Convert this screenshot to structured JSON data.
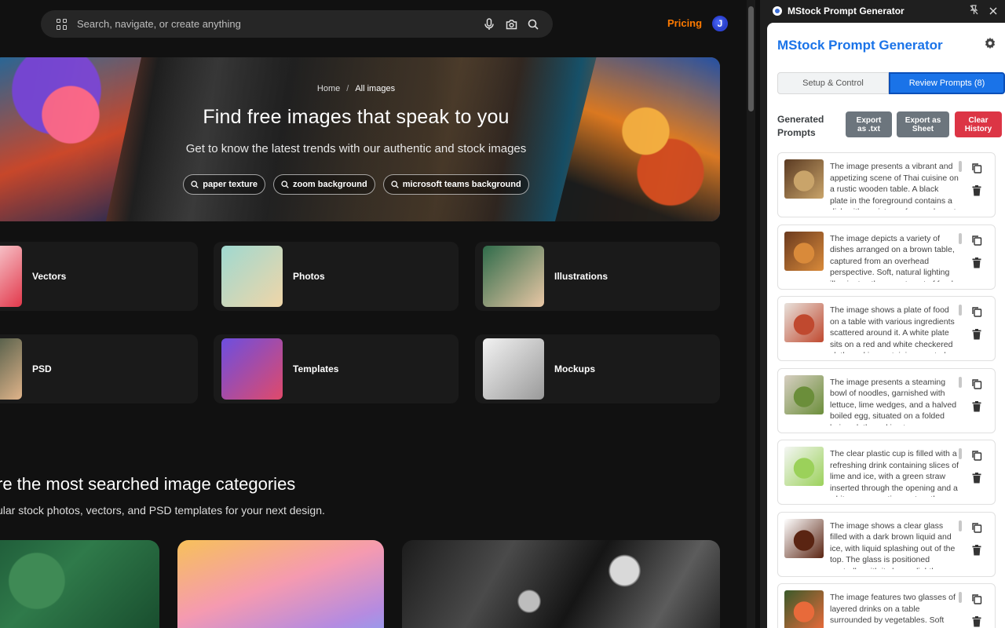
{
  "page": {
    "search_placeholder": "Search, navigate, or create anything",
    "pricing": "Pricing",
    "avatar_initial": "J",
    "hero": {
      "breadcrumb_home": "Home",
      "breadcrumb_separator": "/",
      "breadcrumb_current": "All images",
      "title": "Find free images that speak to you",
      "subtitle": "Get to know the latest trends with our authentic and stock images",
      "tags": [
        "paper texture",
        "zoom background",
        "microsoft teams background"
      ]
    },
    "categories": [
      {
        "label": "Vectors",
        "color_a": "#ffffff",
        "color_b": "#e2384b"
      },
      {
        "label": "Photos",
        "color_a": "#9fd8d0",
        "color_b": "#f0d6a8"
      },
      {
        "label": "Illustrations",
        "color_a": "#2f6b4a",
        "color_b": "#e9c7a5"
      },
      {
        "label": "PSD",
        "color_a": "#1b3b2f",
        "color_b": "#e0b48a"
      },
      {
        "label": "Templates",
        "color_a": "#6c4ee0",
        "color_b": "#e04a6a"
      },
      {
        "label": "Mockups",
        "color_a": "#f2f2f2",
        "color_b": "#9a9a9a"
      }
    ],
    "section_title": "re the most searched image categories",
    "section_subtitle": "ular stock photos, vectors, and PSD templates for your next design."
  },
  "extension": {
    "window_title": "MStock Prompt Generator",
    "heading": "MStock Prompt Generator",
    "tab_setup": "Setup & Control",
    "tab_review": "Review Prompts (8)",
    "generated_label_1": "Generated",
    "generated_label_2": "Prompts",
    "export_txt_1": "Export",
    "export_txt_2": "as .txt",
    "export_sheet_1": "Export as",
    "export_sheet_2": "Sheet",
    "clear_1": "Clear",
    "clear_2": "History",
    "accent": "#1a73e8",
    "prompts": [
      {
        "text": "The image presents a vibrant and appetizing scene of Thai cuisine on a rustic wooden table. A black plate in the foreground contains a dish with a mixture of ground meat",
        "color_a": "#5a3a22",
        "color_b": "#c9a46a"
      },
      {
        "text": "The image depicts a variety of dishes arranged on a brown table, captured from an overhead perspective. Soft, natural lighting illuminates the assortment of food",
        "color_a": "#6b3a1e",
        "color_b": "#d98a3a"
      },
      {
        "text": "The image shows a plate of food on a table with various ingredients scattered around it. A white plate sits on a red and white checkered cloth napkin, containing roasted",
        "color_a": "#e8e2dc",
        "color_b": "#c0492f"
      },
      {
        "text": "The image presents a steaming bowl of noodles, garnished with lettuce, lime wedges, and a halved boiled egg, situated on a folded beige cloth napkin atop a",
        "color_a": "#d7cfc2",
        "color_b": "#6b8e3a"
      },
      {
        "text": "The clear plastic cup is filled with a refreshing drink containing slices of lime and ice, with a green straw inserted through the opening and a white spoon resting on top; the",
        "color_a": "#f4f6f4",
        "color_b": "#9bd15a"
      },
      {
        "text": "The image shows a clear glass filled with a dark brown liquid and ice, with liquid splashing out of the top. The glass is positioned centrally, with its base slightly wider than its",
        "color_a": "#ffffff",
        "color_b": "#5a2412"
      },
      {
        "text": "The image features two glasses of layered drinks on a table surrounded by vegetables. Soft light",
        "color_a": "#3a5a2a",
        "color_b": "#e86a3a"
      }
    ]
  }
}
